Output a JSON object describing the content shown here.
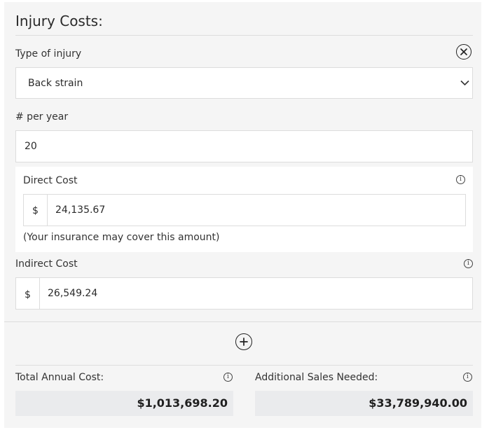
{
  "section": {
    "title": "Injury Costs:"
  },
  "injury": {
    "type_label": "Type of injury",
    "type_value": "Back strain",
    "per_year_label": "# per year",
    "per_year_value": "20"
  },
  "direct_cost": {
    "label": "Direct Cost",
    "currency": "$",
    "value": "24,135.67",
    "note": "(Your insurance may cover this amount)"
  },
  "indirect_cost": {
    "label": "Indirect Cost",
    "currency": "$",
    "value": "26,549.24"
  },
  "totals": {
    "annual_label": "Total Annual Cost:",
    "annual_value": "$1,013,698.20",
    "sales_label": "Additional Sales Needed:",
    "sales_value": "$33,789,940.00"
  },
  "icons": {
    "close": "close-circle-icon",
    "chevron": "chevron-down-icon",
    "info": "info-icon",
    "add": "plus-circle-icon"
  }
}
